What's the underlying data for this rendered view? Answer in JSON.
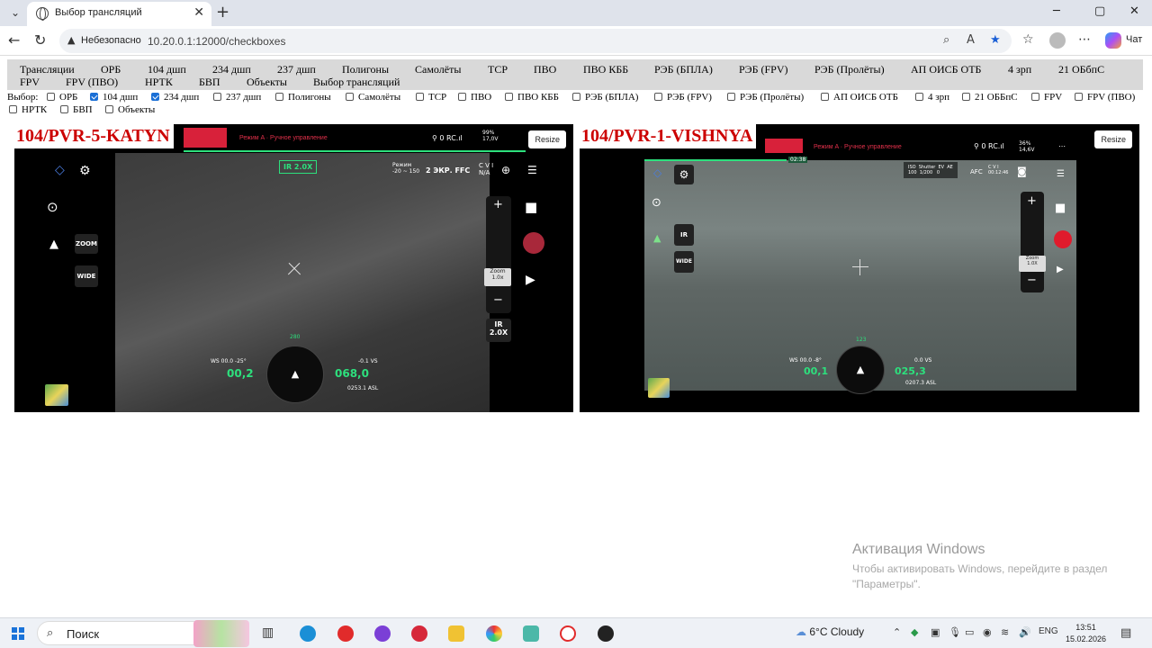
{
  "browser": {
    "tab_title": "Выбор трансляций",
    "insecure_label": "Небезопасно",
    "url": "10.20.0.1:12000/checkboxes",
    "chat_label": "Чат"
  },
  "menu": [
    "Трансляции",
    "ОРБ",
    "104 дшп",
    "234 дшп",
    "237 дшп",
    "Полигоны",
    "Самолёты",
    "ТСР",
    "ПВО",
    "ПВО КББ",
    "РЭБ (БПЛА)",
    "РЭБ (FPV)",
    "РЭБ (Пролёты)",
    "АП ОИСБ ОТБ",
    "4 зрп",
    "21 ОБбпС",
    "FPV",
    "FPV (ПВО)",
    "НРТК",
    "БВП",
    "Объекты",
    "Выбор трансляций"
  ],
  "select_label": "Выбор:",
  "checkboxes": [
    {
      "label": "ОРБ",
      "checked": false
    },
    {
      "label": "104 дшп",
      "checked": true
    },
    {
      "label": "234 дшп",
      "checked": true
    },
    {
      "label": "237 дшп",
      "checked": false
    },
    {
      "label": "Полигоны",
      "checked": false
    },
    {
      "label": "Самолёты",
      "checked": false
    },
    {
      "label": "ТСР",
      "checked": false
    },
    {
      "label": "ПВО",
      "checked": false
    },
    {
      "label": "ПВО КББ",
      "checked": false
    },
    {
      "label": "РЭБ (БПЛА)",
      "checked": false
    },
    {
      "label": "РЭБ (FPV)",
      "checked": false
    },
    {
      "label": "РЭБ (Пролёты)",
      "checked": false
    },
    {
      "label": "АП ОИСБ ОТБ",
      "checked": false
    },
    {
      "label": "4 зрп",
      "checked": false
    },
    {
      "label": "21 ОББпС",
      "checked": false
    },
    {
      "label": "FPV",
      "checked": false
    },
    {
      "label": "FPV (ПВО)",
      "checked": false
    },
    {
      "label": "НРТК",
      "checked": false
    },
    {
      "label": "БВП",
      "checked": false
    },
    {
      "label": "Объекты",
      "checked": false
    }
  ],
  "streams": [
    {
      "name": "104/PVR-5-KATYN",
      "resize_label": "Resize",
      "mode_text": "Режим A · Ручное управление",
      "battery": "99%\n17,0V",
      "ir_box": "IR 2.0X",
      "mode_label": "Режим\n-20 ~ 150",
      "status": "2 ЭКР.  FFC",
      "cvi": "C V I\nN/A",
      "zoom_btn": "ZOOM",
      "wide_btn": "WIDE",
      "zoom_level": "Zoom\n1.0x",
      "ir_level": "IR\n2.0X",
      "ws": "WS 00.0   -25°",
      "speed": "00,2",
      "alt": "068,0",
      "vs": "-0.1 VS",
      "asl": "0253.1 ASL",
      "heading": "280"
    },
    {
      "name": "104/PVR-1-VISHNYA",
      "resize_label": "Resize",
      "mode_text": "Режим A · Ручное управление",
      "battery": "36%\n14,6V",
      "timer": "02:38",
      "camera_info": "ISO  Shutter  EV  AE\n100  1/200   0   ",
      "afc": "AFC",
      "cvi": "C V I\n00:12:46",
      "ir_btn": "IR",
      "wide_btn": "WIDE",
      "zoom_level": "Zoom\n1.0X",
      "ws": "WS 00.0   -8°",
      "speed": "00,1",
      "alt": "025,3",
      "vs": "0.0 VS",
      "asl": "0207.3 ASL",
      "heading": "123"
    }
  ],
  "watermark": {
    "title": "Активация Windows",
    "subtitle": "Чтобы активировать Windows, перейдите в раздел \"Параметры\"."
  },
  "taskbar": {
    "search_placeholder": "Поиск",
    "weather": "6°C  Cloudy",
    "lang": "ENG",
    "time": "13:51",
    "date": "15.02.2026"
  }
}
